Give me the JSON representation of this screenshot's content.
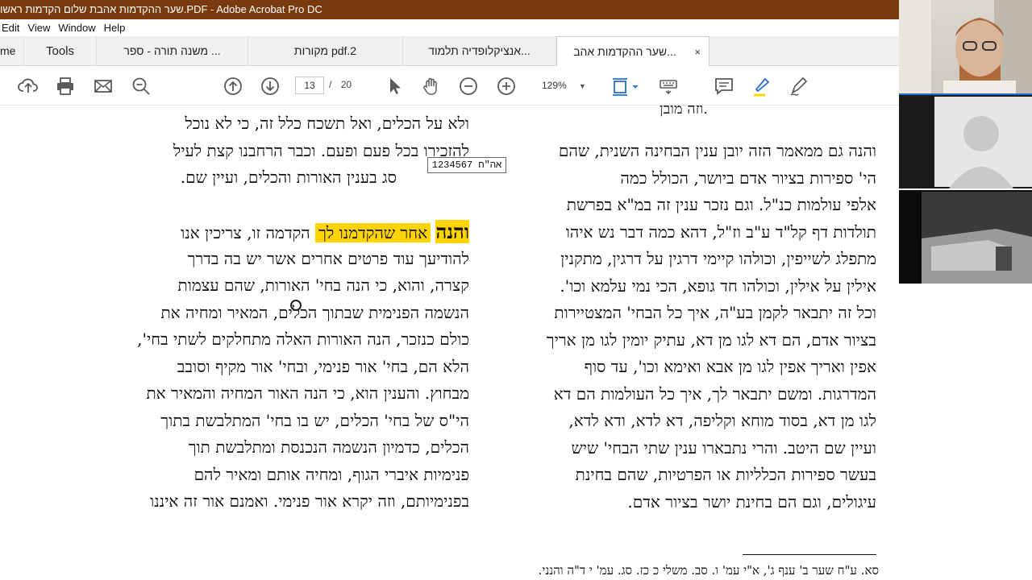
{
  "window": {
    "title": "שער ההקדמות אהבת שלום הקדמות ראשו.PDF - Adobe Acrobat Pro DC"
  },
  "menu": [
    "Edit",
    "View",
    "Window",
    "Help"
  ],
  "tabs": {
    "home": "me",
    "tools": "Tools",
    "items": [
      "משנה תורה - ספר ...",
      "מקורות pdf.2",
      "אנציקלופדיה תלמוד...",
      "שער ההקדמות אהב..."
    ],
    "close": "×"
  },
  "toolbar": {
    "page_current": "13",
    "page_separator": "/",
    "page_total": "20",
    "zoom": "129%"
  },
  "document": {
    "top_fragment": "וזה מובן.",
    "stamp": "אה\"ח 1234567",
    "left_column": [
      "ולא על הכלים, ואל תשכח כלל זה, כי לא נוכל",
      "להזכירו בכל פעם ופעם. וכבר הרחבנו קצת לעיל",
      "סג בענין האורות והכלים, ועיין שם.",
      "",
      "והנה אחר שהקדמנו לך הקדמה זו, צריכין אנו",
      "להודיעך עוד פרטים אחרים אשר יש בה בדרך",
      "קצרה, והוא, כי הנה בחי' האורות, שהם עצמות",
      "הנשמה הפנימית שבתוך הכלים, המאיר ומחיה את",
      "כולם כנזכר, הנה האורות האלה מתחלקים לשתי בחי',",
      "הלא הם, בחי' אור פנימי, ובחי' אור מקיף וסובב",
      "מבחוץ. והענין הוא, כי הנה האור המחיה והמאיר את",
      "הי\"ס של בחי' הכלים, יש בו בחי' המתלבשת בתוך",
      "הכלים, כדמיון הנשמה הנכנסת ומתלבשת תוך",
      "פנימיות איברי הגוף, ומחיה אותם ומאיר להם",
      "בפנימיותם, וזה יקרא אור פנימי. ואמנם אור זה איננו"
    ],
    "left_highlight_word": "והנה",
    "left_highlight_rest": "אחר שהקדמנו לך",
    "left_line5_tail": "הקדמה זו, צריכין אנו",
    "right_column": [
      "והנה גם ממאמר הזה יובן ענין הבחינה השנית, שהם",
      "הי' ספירות בציור אדם ביושר, הכולל כמה",
      "אלפי עולמות כנ\"ל. וגם נזכר ענין זה במ\"א בפרשת",
      "תולדות דף קל\"ד ע\"ב וז\"ל, דהא כמה דבר נש איהו",
      "מתפלג לשייפין, וכולהו קיימי דרגין על דרגין, מתקנין",
      "אילין על אילין, וכולהו חד גופא, הכי נמי עלמא וכו'.",
      "וכל זה יתבאר לקמן בע\"ה, איך כל הבחי' המצטיירות",
      "בציור אדם, הם דא לגו מן דא, עתיק יומין לגו מן אריך",
      "אפין ואריך אפין לגו מן אבא ואימא וכו', עד סוף",
      "המדרגות. ומשם יתבאר לך, איך כל העולמות הם דא",
      "לגו מן דא, בסוד מוחא וקליפה, דא לדא, ודא לדא,",
      "ועיין שם היטב. והרי נתבארו ענין שתי הבחי' שיש",
      "בעשר ספירות הכלליות או הפרטיות, שהם בחינת",
      "עיגולים, וגם הם בחינת יושר בציור אדם."
    ],
    "footnote": "סא. ע\"ח שער ב' ענף ג', א\"י עמ' ו.   סב. משלי כ כז.   סג. עמ' י ד\"ה והנני."
  },
  "icons": {
    "upload": "upload-icon",
    "print": "print-icon",
    "mail": "mail-icon",
    "zoom_search": "zoom-search-icon",
    "page_up": "page-up-icon",
    "page_down": "page-down-icon",
    "select": "select-arrow-icon",
    "hand": "hand-icon",
    "zoom_out": "zoom-out-icon",
    "zoom_in": "zoom-in-icon",
    "fit": "fit-page-icon",
    "keyboard": "keyboard-icon",
    "comment": "comment-icon",
    "highlighter": "highlighter-icon",
    "sign": "sign-icon"
  },
  "colors": {
    "titlebar": "#7a3a0d",
    "highlight": "#ffd400",
    "video_accent": "#1f6fd0"
  }
}
